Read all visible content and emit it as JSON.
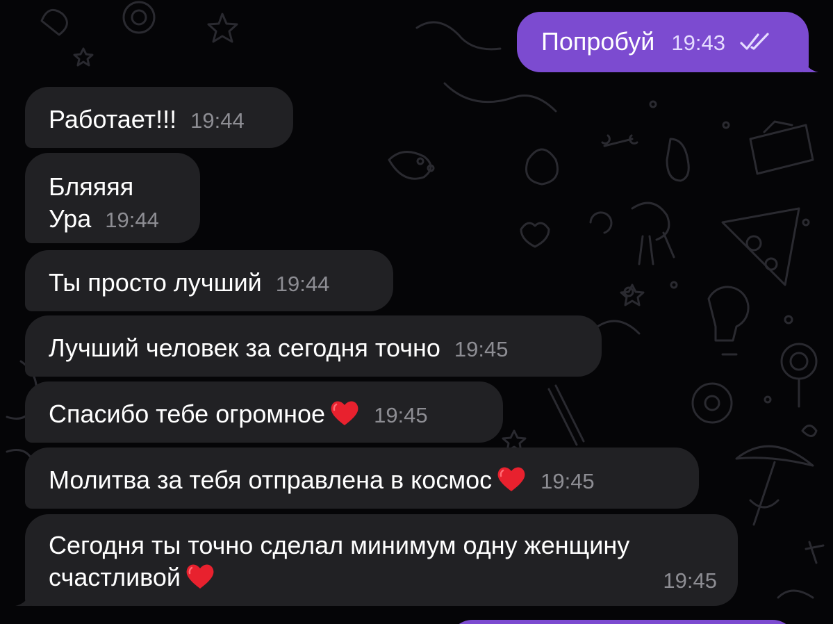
{
  "messages": [
    {
      "direction": "outgoing",
      "text": "Попробуй",
      "time": "19:43",
      "status_icon": "double-check-icon"
    },
    {
      "direction": "incoming",
      "text": "Работает!!!",
      "time": "19:44"
    },
    {
      "direction": "incoming",
      "text_line1": "Бляяяя",
      "text_line2": "Ура",
      "time": "19:44"
    },
    {
      "direction": "incoming",
      "text": "Ты просто лучший",
      "time": "19:44"
    },
    {
      "direction": "incoming",
      "text": "Лучший человек за сегодня точно",
      "time": "19:45"
    },
    {
      "direction": "incoming",
      "text": "Спасибо тебе огромное",
      "emoji": "heart-icon",
      "time": "19:45"
    },
    {
      "direction": "incoming",
      "text": "Молитва за тебя отправлена в космос",
      "emoji": "heart-icon",
      "time": "19:45"
    },
    {
      "direction": "incoming",
      "text_line1": "Сегодня ты точно сделал минимум одну женщину",
      "text_line2": "счастливой",
      "emoji": "heart-icon",
      "time": "19:45"
    }
  ],
  "colors": {
    "background": "#050507",
    "incoming_bubble": "#212124",
    "outgoing_bubble": "#7c4bd0",
    "timestamp": "#8d8d93",
    "heart": "#e8212e"
  }
}
